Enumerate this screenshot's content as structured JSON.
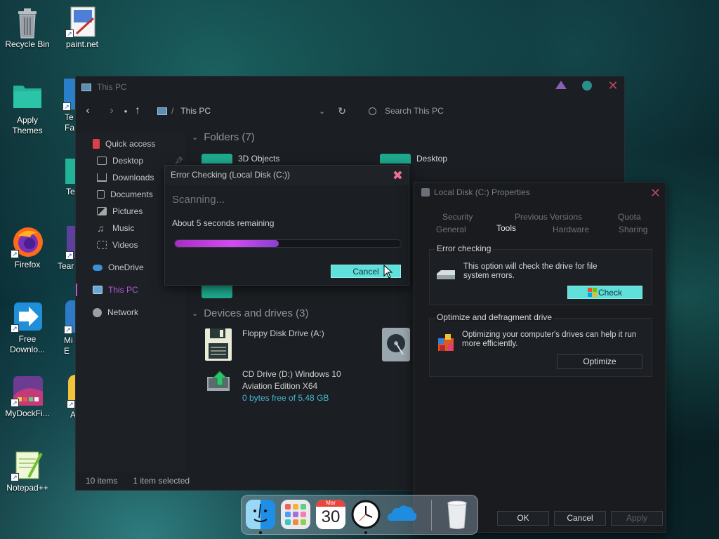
{
  "desktop": {
    "icons": [
      {
        "label": "Recycle Bin"
      },
      {
        "label": "paint.net"
      },
      {
        "label": "Apply Themes"
      },
      {
        "label": "Te Fa"
      },
      {
        "label": "Te"
      },
      {
        "label": "Firefox"
      },
      {
        "label": "Tear"
      },
      {
        "label": "Free Downlo..."
      },
      {
        "label": "Mi E"
      },
      {
        "label": "MyDockFi..."
      },
      {
        "label": "A"
      },
      {
        "label": "Notepad++"
      }
    ]
  },
  "explorer": {
    "title": "This PC",
    "path_sep": "/",
    "path": "This PC",
    "search_placeholder": "Search This PC",
    "sidebar": [
      {
        "label": "Quick access",
        "icon": "star-icon",
        "color": "#e04b4b"
      },
      {
        "label": "Desktop",
        "icon": "desktop-icon",
        "color": "#5aa0c8"
      },
      {
        "label": "Downloads",
        "icon": "download-icon",
        "color": "#8fa06a"
      },
      {
        "label": "Documents",
        "icon": "documents-icon",
        "color": "#a7a7a7"
      },
      {
        "label": "Pictures",
        "icon": "pictures-icon",
        "color": "#a7a7a7"
      },
      {
        "label": "Music",
        "icon": "music-icon",
        "color": "#a7a7a7"
      },
      {
        "label": "Videos",
        "icon": "videos-icon",
        "color": "#a7a7a7"
      },
      {
        "label": "OneDrive",
        "icon": "cloud-icon",
        "color": "#3b8fd6"
      },
      {
        "label": "This PC",
        "icon": "pc-icon",
        "color": "#6aa7d6"
      },
      {
        "label": "Network",
        "icon": "network-icon",
        "color": "#9aa0a6"
      }
    ],
    "folders_header": "Folders (7)",
    "folders": [
      "3D Objects",
      "Desktop"
    ],
    "devices_header": "Devices and drives (3)",
    "drives": [
      {
        "name": "Floppy Disk Drive (A:)"
      },
      {
        "name_line1": "CD Drive (D:) Windows 10",
        "name_line2": "Aviation Edition X64",
        "free": "0 bytes free of 5.48 GB"
      }
    ],
    "status_items": "10 items",
    "status_selected": "1 item selected"
  },
  "error_dialog": {
    "title": "Error Checking (Local Disk (C:))",
    "scanning": "Scanning...",
    "remaining": "About 5 seconds remaining",
    "progress_fraction": 0.46,
    "cancel_label": "Cancel"
  },
  "properties": {
    "title": "Local Disk (C:) Properties",
    "tabs_row1": [
      "Security",
      "Previous Versions",
      "Quota"
    ],
    "tabs_row2": [
      "General",
      "Tools",
      "Hardware",
      "Sharing"
    ],
    "active_tab": "Tools",
    "error_checking": {
      "title": "Error checking",
      "desc_line1": "This option will check the drive for file",
      "desc_line2": "system errors.",
      "button": "Check"
    },
    "optimize": {
      "title": "Optimize and defragment drive",
      "desc_line1": "Optimizing your computer's drives can help it run",
      "desc_line2": "more efficiently.",
      "button": "Optimize"
    },
    "ok": "OK",
    "cancel": "Cancel",
    "apply": "Apply"
  },
  "dock": {
    "calendar_month": "Mar",
    "calendar_day": "30"
  }
}
